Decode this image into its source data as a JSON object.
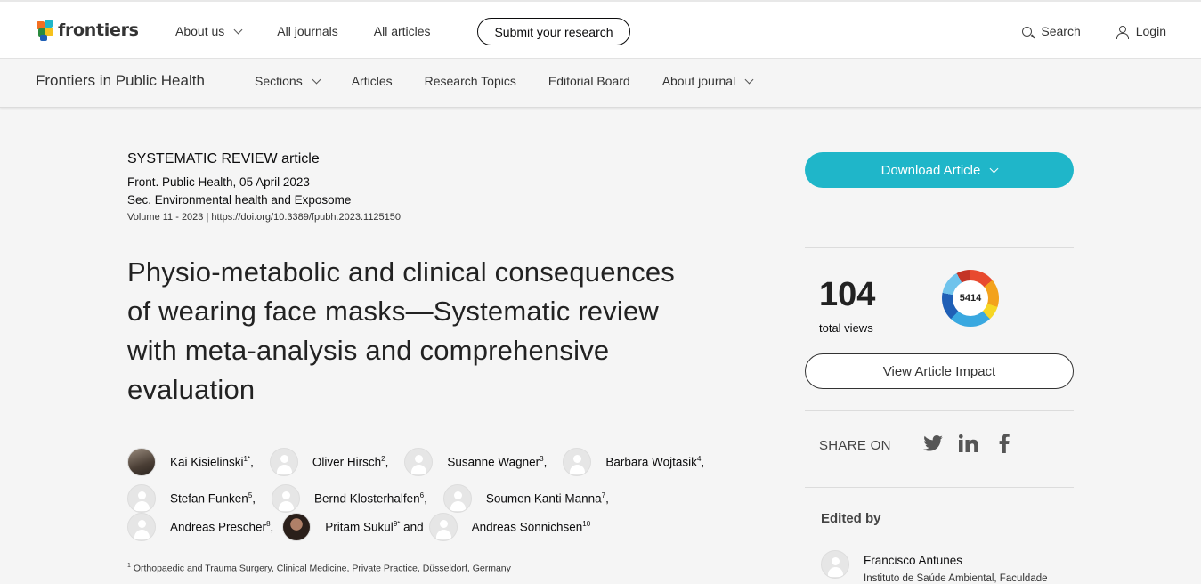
{
  "brand": {
    "logo_text": "frontiers"
  },
  "topnav": {
    "items": [
      "About us",
      "All journals",
      "All articles"
    ],
    "submit": "Submit your research",
    "search": "Search",
    "login": "Login"
  },
  "journal": {
    "title": "Frontiers in Public Health",
    "nav": [
      "Sections",
      "Articles",
      "Research Topics",
      "Editorial Board",
      "About journal"
    ]
  },
  "article": {
    "type_main": "SYSTEMATIC REVIEW",
    "type_suffix": "article",
    "citation": "Front. Public Health, 05 April 2023",
    "section": "Sec. Environmental health and Exposome",
    "volume_doi": "Volume 11 - 2023 | https://doi.org/10.3389/fpubh.2023.1125150",
    "title": "Physio-metabolic and clinical consequences of wearing face masks—Systematic review with meta-analysis and comprehensive evaluation",
    "affiliation_1": "Orthopaedic and Trauma Surgery, Clinical Medicine, Private Practice, Düsseldorf, Germany",
    "affiliation_1_num": "1"
  },
  "authors": [
    {
      "name": "Kai Kisielinski",
      "sup": "1*",
      "sep": ","
    },
    {
      "name": "Oliver Hirsch",
      "sup": "2",
      "sep": ","
    },
    {
      "name": "Susanne Wagner",
      "sup": "3",
      "sep": ","
    },
    {
      "name": "Barbara Wojtasik",
      "sup": "4",
      "sep": ","
    },
    {
      "name": "Stefan Funken",
      "sup": "5",
      "sep": ","
    },
    {
      "name": "Bernd Klosterhalfen",
      "sup": "6",
      "sep": ","
    },
    {
      "name": "Soumen Kanti Manna",
      "sup": "7",
      "sep": ","
    },
    {
      "name": "Andreas Prescher",
      "sup": "8",
      "sep": ","
    },
    {
      "name": "Pritam Sukul",
      "sup": "9*",
      "sep": " and"
    },
    {
      "name": "Andreas Sönnichsen",
      "sup": "10",
      "sep": ""
    }
  ],
  "sidebar": {
    "download": "Download Article",
    "views_count": "104",
    "views_label": "total views",
    "altmetric_score": "5414",
    "impact": "View Article Impact",
    "share_label": "SHARE ON",
    "edited_by": "Edited by",
    "editor_name": "Francisco Antunes",
    "editor_institution": "Instituto de Saúde Ambiental, Faculdade"
  }
}
